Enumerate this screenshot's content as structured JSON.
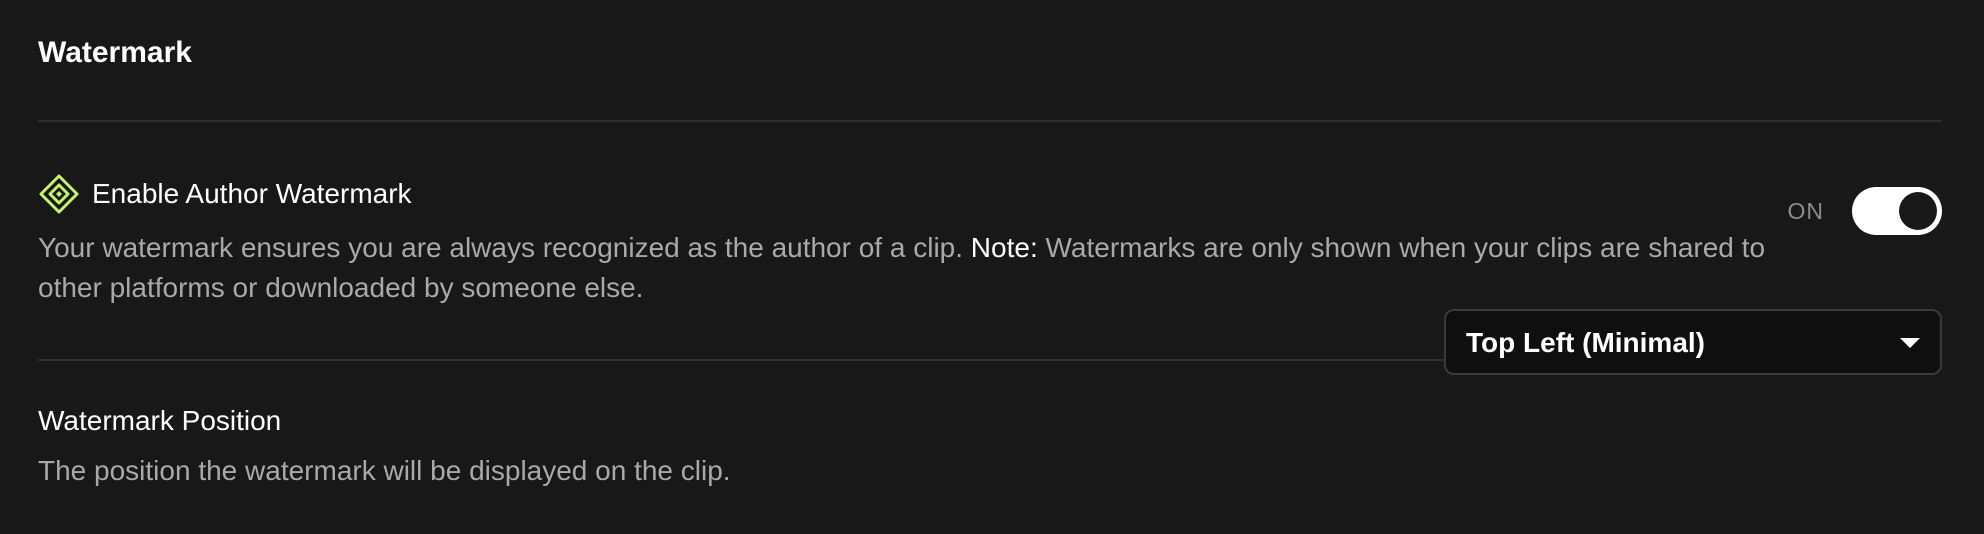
{
  "section": {
    "title": "Watermark"
  },
  "author_watermark": {
    "label": "Enable Author Watermark",
    "icon": "diamond-logo-icon",
    "icon_color": "#c6f26e",
    "description_main": "Your watermark ensures you are always recognized as the author of a clip.",
    "note_label": "Note:",
    "note_text": "Watermarks are only shown when your clips are shared to other platforms or downloaded by someone else.",
    "toggle_state": "ON",
    "enabled": true
  },
  "watermark_position": {
    "label": "Watermark Position",
    "description": "The position the watermark will be displayed on the clip.",
    "selected": "Top Left (Minimal)",
    "chevron_icon": "chevron-down-icon"
  }
}
